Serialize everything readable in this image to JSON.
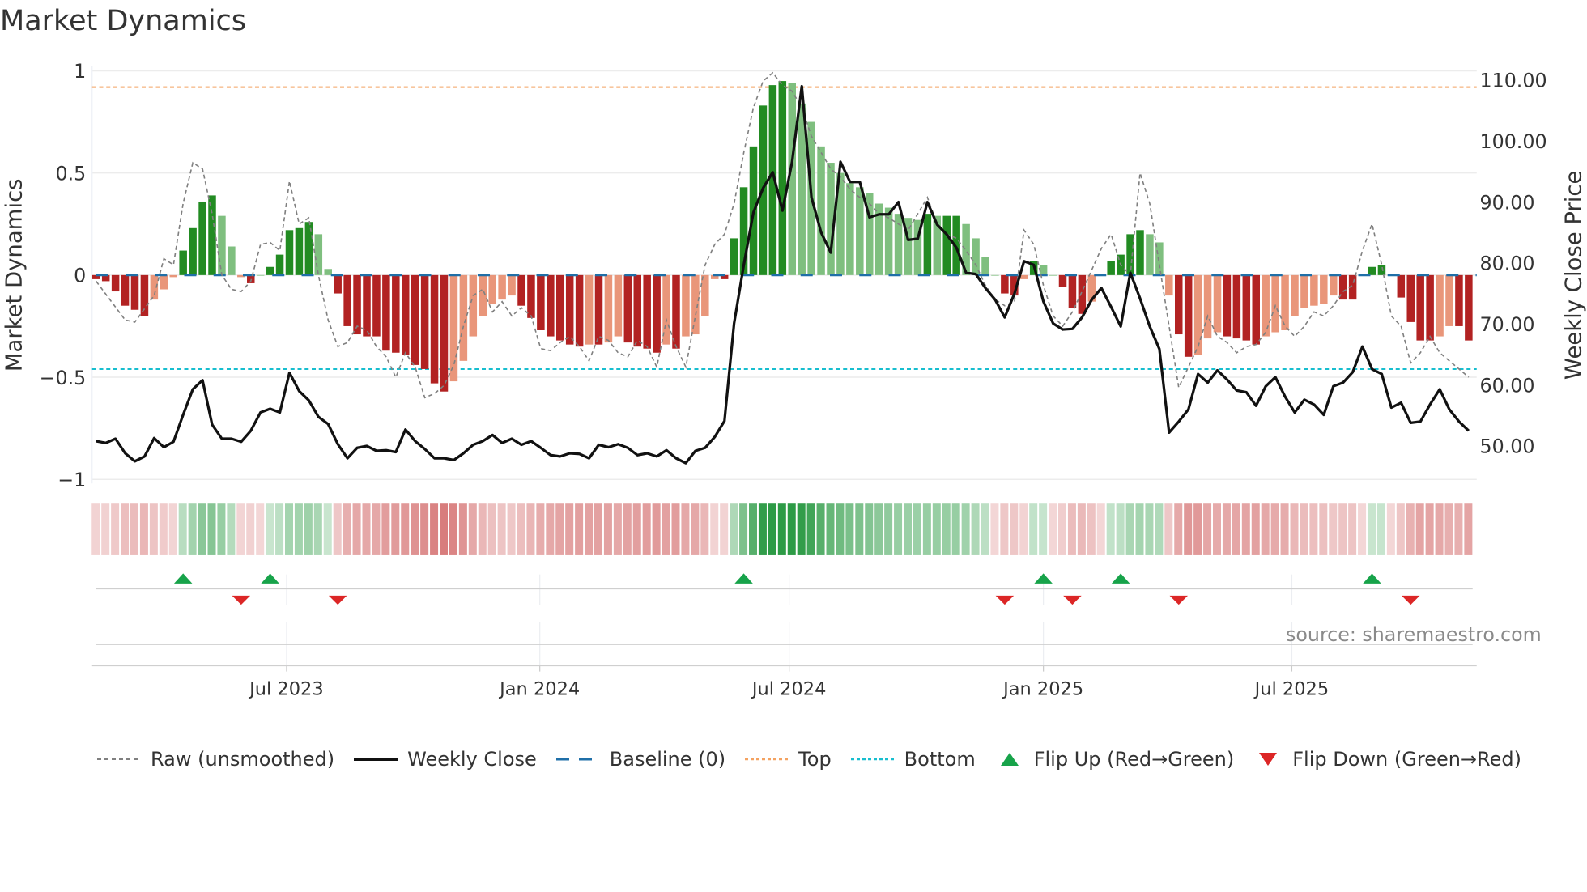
{
  "title": "Market Dynamics",
  "source": "source: sharemaestro.com",
  "colors": {
    "pos_strong": "#228b22",
    "pos_weak": "#7fbf7f",
    "neg_strong": "#b22222",
    "neg_weak": "#e9967a",
    "price": "#111111",
    "raw": "#808080",
    "baseline": "#1f6fa8",
    "top": "#f4a261",
    "bottom": "#17becf",
    "flip_up": "#17a34a",
    "flip_down": "#dc2626"
  },
  "legend": [
    {
      "label": "Raw (unsmoothed)",
      "key": "raw"
    },
    {
      "label": "Weekly Close",
      "key": "price"
    },
    {
      "label": "Baseline (0)",
      "key": "baseline"
    },
    {
      "label": "Top",
      "key": "top"
    },
    {
      "label": "Bottom",
      "key": "bottom"
    },
    {
      "label": "Flip Up (Red→Green)",
      "key": "flip_up"
    },
    {
      "label": "Flip Down (Green→Red)",
      "key": "flip_down"
    }
  ],
  "chart_data": {
    "type": "bar",
    "title": "Market Dynamics",
    "ylabel": "Market Dynamics",
    "y2label": "Weekly Close Price",
    "ylim": [
      -1,
      1
    ],
    "y2lim": [
      44.3,
      111.5
    ],
    "yticks": [
      "1",
      "0.5",
      "0",
      "−0.5",
      "−1"
    ],
    "ytick_values": [
      1,
      0.5,
      0,
      -0.5,
      -1
    ],
    "y2ticks": [
      "110.00",
      "100.00",
      "90.00",
      "80.00",
      "70.00",
      "60.00",
      "50.00"
    ],
    "y2tick_values": [
      110,
      100,
      90,
      80,
      70,
      60,
      50
    ],
    "xticks": [
      {
        "label": "Jul 2023",
        "week": 19.7
      },
      {
        "label": "Jan 2024",
        "week": 45.9
      },
      {
        "label": "Jul 2024",
        "week": 71.7
      },
      {
        "label": "Jan 2025",
        "week": 98.0
      },
      {
        "label": "Jul 2025",
        "week": 123.7
      }
    ],
    "top_level": 0.92,
    "bottom_level": -0.46,
    "baseline": 0,
    "momentum": [
      -0.02,
      -0.03,
      -0.08,
      -0.15,
      -0.17,
      -0.2,
      -0.12,
      -0.07,
      -0.01,
      0.12,
      0.23,
      0.36,
      0.39,
      0.29,
      0.14,
      -0.01,
      -0.04,
      0.0,
      0.04,
      0.1,
      0.22,
      0.23,
      0.26,
      0.2,
      0.03,
      -0.09,
      -0.25,
      -0.29,
      -0.3,
      -0.3,
      -0.37,
      -0.38,
      -0.39,
      -0.44,
      -0.46,
      -0.53,
      -0.57,
      -0.52,
      -0.42,
      -0.3,
      -0.2,
      -0.14,
      -0.12,
      -0.1,
      -0.15,
      -0.21,
      -0.27,
      -0.3,
      -0.32,
      -0.34,
      -0.35,
      -0.34,
      -0.34,
      -0.33,
      -0.3,
      -0.33,
      -0.35,
      -0.36,
      -0.38,
      -0.34,
      -0.36,
      -0.3,
      -0.29,
      -0.2,
      -0.02,
      -0.02,
      0.18,
      0.43,
      0.63,
      0.83,
      0.93,
      0.95,
      0.94,
      0.84,
      0.75,
      0.63,
      0.55,
      0.5,
      0.45,
      0.43,
      0.4,
      0.35,
      0.33,
      0.3,
      0.28,
      0.27,
      0.3,
      0.29,
      0.29,
      0.29,
      0.25,
      0.18,
      0.09,
      0.0,
      -0.09,
      -0.1,
      -0.02,
      0.07,
      0.05,
      0.0,
      -0.06,
      -0.16,
      -0.19,
      -0.13,
      0.0,
      0.07,
      0.1,
      0.2,
      0.22,
      0.2,
      0.16,
      -0.1,
      -0.29,
      -0.4,
      -0.39,
      -0.31,
      -0.28,
      -0.3,
      -0.31,
      -0.32,
      -0.34,
      -0.3,
      -0.28,
      -0.27,
      -0.2,
      -0.16,
      -0.15,
      -0.14,
      -0.1,
      -0.12,
      -0.12,
      0.0,
      0.04,
      0.05,
      0.0,
      -0.11,
      -0.23,
      -0.32,
      -0.32,
      -0.3,
      -0.25,
      -0.25,
      -0.32
    ],
    "weekly_close": [
      50.8,
      50.5,
      51.2,
      48.8,
      47.5,
      48.3,
      51.3,
      49.8,
      50.7,
      55.1,
      59.3,
      60.8,
      53.5,
      51.2,
      51.2,
      50.7,
      52.5,
      55.5,
      56.1,
      55.5,
      62.0,
      59.0,
      57.5,
      54.8,
      53.6,
      50.3,
      48.0,
      49.7,
      50.0,
      49.2,
      49.3,
      49.0,
      52.7,
      50.8,
      49.5,
      48.0,
      48.0,
      47.7,
      48.8,
      50.2,
      50.8,
      51.8,
      50.5,
      51.2,
      50.2,
      50.8,
      49.7,
      48.5,
      48.3,
      48.8,
      48.7,
      48.0,
      50.2,
      49.8,
      50.3,
      49.7,
      48.5,
      48.8,
      48.3,
      49.3,
      48.0,
      47.2,
      49.2,
      49.7,
      51.5,
      54.1,
      70.1,
      79.7,
      88.3,
      92.3,
      94.9,
      88.6,
      96.6,
      109.0,
      90.8,
      85.0,
      81.7,
      96.6,
      93.3,
      93.3,
      87.5,
      88.0,
      88.0,
      90.0,
      83.8,
      84.0,
      90.0,
      86.3,
      84.7,
      82.5,
      78.4,
      78.2,
      75.9,
      74.0,
      71.1,
      75.0,
      80.3,
      79.7,
      73.7,
      70.1,
      69.1,
      69.2,
      71.1,
      74.0,
      75.9,
      72.8,
      69.6,
      78.4,
      74.2,
      69.6,
      65.9,
      52.2,
      54.0,
      56.0,
      61.8,
      60.4,
      62.4,
      60.9,
      59.1,
      58.8,
      56.6,
      59.8,
      61.3,
      58.1,
      55.5,
      57.6,
      56.8,
      55.1,
      59.8,
      60.4,
      62.1,
      66.3,
      62.6,
      61.8,
      56.3,
      57.1,
      53.8,
      54.0,
      56.8,
      59.3,
      56.0,
      54.0,
      52.5
    ],
    "raw_points": [
      [
        0,
        -0.03
      ],
      [
        3,
        -0.22
      ],
      [
        4,
        -0.23
      ],
      [
        6,
        -0.1
      ],
      [
        7,
        0.08
      ],
      [
        8,
        0.05
      ],
      [
        9,
        0.35
      ],
      [
        10,
        0.55
      ],
      [
        11,
        0.52
      ],
      [
        12,
        0.3
      ],
      [
        13,
        0.0
      ],
      [
        14,
        -0.07
      ],
      [
        15,
        -0.08
      ],
      [
        16,
        -0.03
      ],
      [
        17,
        0.15
      ],
      [
        18,
        0.16
      ],
      [
        19,
        0.12
      ],
      [
        20,
        0.46
      ],
      [
        21,
        0.25
      ],
      [
        22,
        0.28
      ],
      [
        23,
        0.0
      ],
      [
        24,
        -0.22
      ],
      [
        25,
        -0.35
      ],
      [
        26,
        -0.33
      ],
      [
        27,
        -0.25
      ],
      [
        28,
        -0.27
      ],
      [
        29,
        -0.35
      ],
      [
        30,
        -0.4
      ],
      [
        31,
        -0.5
      ],
      [
        32,
        -0.38
      ],
      [
        33,
        -0.45
      ],
      [
        34,
        -0.6
      ],
      [
        35,
        -0.58
      ],
      [
        36,
        -0.54
      ],
      [
        37,
        -0.44
      ],
      [
        38,
        -0.25
      ],
      [
        39,
        -0.1
      ],
      [
        40,
        -0.07
      ],
      [
        41,
        -0.18
      ],
      [
        42,
        -0.13
      ],
      [
        43,
        -0.2
      ],
      [
        44,
        -0.16
      ],
      [
        45,
        -0.2
      ],
      [
        46,
        -0.36
      ],
      [
        47,
        -0.37
      ],
      [
        48,
        -0.33
      ],
      [
        49,
        -0.3
      ],
      [
        50,
        -0.35
      ],
      [
        51,
        -0.42
      ],
      [
        52,
        -0.3
      ],
      [
        53,
        -0.32
      ],
      [
        54,
        -0.38
      ],
      [
        55,
        -0.4
      ],
      [
        56,
        -0.32
      ],
      [
        57,
        -0.35
      ],
      [
        58,
        -0.45
      ],
      [
        59,
        -0.22
      ],
      [
        60,
        -0.35
      ],
      [
        61,
        -0.45
      ],
      [
        62,
        -0.2
      ],
      [
        63,
        0.05
      ],
      [
        64,
        0.15
      ],
      [
        65,
        0.2
      ],
      [
        66,
        0.35
      ],
      [
        67,
        0.6
      ],
      [
        68,
        0.82
      ],
      [
        69,
        0.95
      ],
      [
        70,
        0.99
      ],
      [
        71,
        0.93
      ],
      [
        72,
        0.9
      ],
      [
        73,
        0.82
      ],
      [
        74,
        0.68
      ],
      [
        75,
        0.6
      ],
      [
        76,
        0.52
      ],
      [
        77,
        0.48
      ],
      [
        78,
        0.42
      ],
      [
        79,
        0.38
      ],
      [
        80,
        0.35
      ],
      [
        81,
        0.3
      ],
      [
        82,
        0.28
      ],
      [
        83,
        0.25
      ],
      [
        84,
        0.22
      ],
      [
        86,
        0.38
      ],
      [
        87,
        0.25
      ],
      [
        88,
        0.2
      ],
      [
        89,
        0.18
      ],
      [
        90,
        0.12
      ],
      [
        91,
        0.05
      ],
      [
        92,
        -0.05
      ],
      [
        93,
        -0.12
      ],
      [
        94,
        -0.15
      ],
      [
        95,
        -0.13
      ],
      [
        96,
        0.22
      ],
      [
        97,
        0.15
      ],
      [
        98,
        -0.05
      ],
      [
        99,
        -0.2
      ],
      [
        100,
        -0.25
      ],
      [
        101,
        -0.18
      ],
      [
        102,
        -0.08
      ],
      [
        104,
        0.13
      ],
      [
        105,
        0.2
      ],
      [
        106,
        0.05
      ],
      [
        107,
        0.0
      ],
      [
        108,
        0.5
      ],
      [
        109,
        0.35
      ],
      [
        110,
        0.05
      ],
      [
        111,
        -0.25
      ],
      [
        112,
        -0.55
      ],
      [
        113,
        -0.45
      ],
      [
        114,
        -0.35
      ],
      [
        115,
        -0.2
      ],
      [
        116,
        -0.3
      ],
      [
        117,
        -0.33
      ],
      [
        118,
        -0.38
      ],
      [
        119,
        -0.35
      ],
      [
        120,
        -0.34
      ],
      [
        121,
        -0.28
      ],
      [
        122,
        -0.15
      ],
      [
        123,
        -0.25
      ],
      [
        124,
        -0.3
      ],
      [
        125,
        -0.25
      ],
      [
        126,
        -0.18
      ],
      [
        127,
        -0.2
      ],
      [
        128,
        -0.15
      ],
      [
        129,
        -0.08
      ],
      [
        130,
        -0.05
      ],
      [
        131,
        0.12
      ],
      [
        132,
        0.25
      ],
      [
        133,
        0.05
      ],
      [
        134,
        -0.2
      ],
      [
        135,
        -0.25
      ],
      [
        136,
        -0.43
      ],
      [
        137,
        -0.38
      ],
      [
        138,
        -0.3
      ],
      [
        139,
        -0.38
      ],
      [
        140,
        -0.42
      ],
      [
        142,
        -0.5
      ]
    ],
    "flip_up_weeks": [
      9,
      18,
      67,
      98,
      106,
      132
    ],
    "flip_down_weeks": [
      15,
      25,
      94,
      101,
      112,
      136
    ],
    "legend_position": "bottom"
  }
}
